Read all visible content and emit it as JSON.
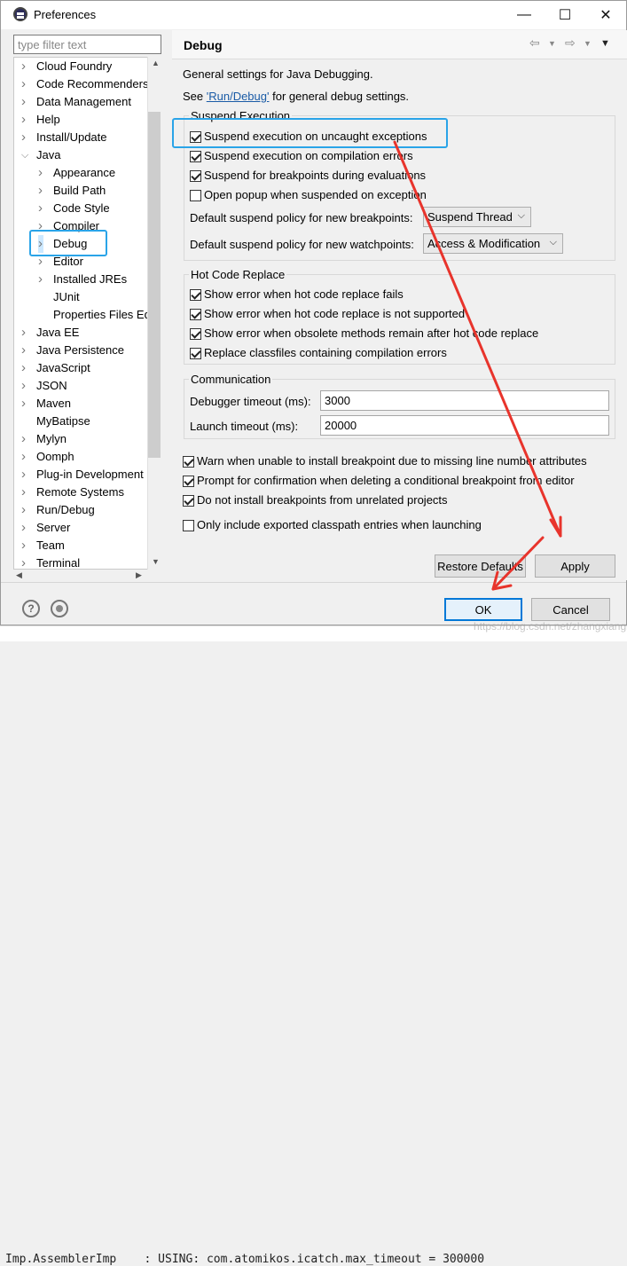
{
  "window": {
    "title": "Preferences",
    "minimize": "—",
    "maximize": "☐",
    "close": "✕"
  },
  "sidebar": {
    "filter_placeholder": "type filter text",
    "items": [
      {
        "label": "Cloud Foundry",
        "level": 0,
        "expand": "closed"
      },
      {
        "label": "Code Recommenders",
        "level": 0,
        "expand": "closed"
      },
      {
        "label": "Data Management",
        "level": 0,
        "expand": "closed"
      },
      {
        "label": "Help",
        "level": 0,
        "expand": "closed"
      },
      {
        "label": "Install/Update",
        "level": 0,
        "expand": "closed"
      },
      {
        "label": "Java",
        "level": 0,
        "expand": "open"
      },
      {
        "label": "Appearance",
        "level": 1,
        "expand": "closed"
      },
      {
        "label": "Build Path",
        "level": 1,
        "expand": "closed"
      },
      {
        "label": "Code Style",
        "level": 1,
        "expand": "closed"
      },
      {
        "label": "Compiler",
        "level": 1,
        "expand": "closed"
      },
      {
        "label": "Debug",
        "level": 1,
        "expand": "closed",
        "selected": true
      },
      {
        "label": "Editor",
        "level": 1,
        "expand": "closed"
      },
      {
        "label": "Installed JREs",
        "level": 1,
        "expand": "closed"
      },
      {
        "label": "JUnit",
        "level": 1,
        "expand": "none"
      },
      {
        "label": "Properties Files Ed",
        "level": 1,
        "expand": "none"
      },
      {
        "label": "Java EE",
        "level": 0,
        "expand": "closed"
      },
      {
        "label": "Java Persistence",
        "level": 0,
        "expand": "closed"
      },
      {
        "label": "JavaScript",
        "level": 0,
        "expand": "closed"
      },
      {
        "label": "JSON",
        "level": 0,
        "expand": "closed"
      },
      {
        "label": "Maven",
        "level": 0,
        "expand": "closed"
      },
      {
        "label": "MyBatipse",
        "level": 0,
        "expand": "none"
      },
      {
        "label": "Mylyn",
        "level": 0,
        "expand": "closed"
      },
      {
        "label": "Oomph",
        "level": 0,
        "expand": "closed"
      },
      {
        "label": "Plug-in Development",
        "level": 0,
        "expand": "closed"
      },
      {
        "label": "Remote Systems",
        "level": 0,
        "expand": "closed"
      },
      {
        "label": "Run/Debug",
        "level": 0,
        "expand": "closed"
      },
      {
        "label": "Server",
        "level": 0,
        "expand": "closed"
      },
      {
        "label": "Team",
        "level": 0,
        "expand": "closed"
      },
      {
        "label": "Terminal",
        "level": 0,
        "expand": "closed"
      }
    ]
  },
  "page": {
    "title": "Debug",
    "intro": "General settings for Java Debugging.",
    "see_prefix": "See ",
    "see_link": "'Run/Debug'",
    "see_suffix": " for general debug settings.",
    "suspend": {
      "group_label": "Suspend Execution",
      "options": [
        {
          "label": "Suspend execution on uncaught exceptions",
          "checked": true
        },
        {
          "label": "Suspend execution on compilation errors",
          "checked": true
        },
        {
          "label": "Suspend for breakpoints during evaluations",
          "checked": true
        },
        {
          "label": "Open popup when suspended on exception",
          "checked": false
        }
      ],
      "bp_policy_label": "Default suspend policy for new breakpoints:",
      "bp_policy_value": "Suspend Thread",
      "wp_policy_label": "Default suspend policy for new watchpoints:",
      "wp_policy_value": "Access & Modification"
    },
    "hcr": {
      "group_label": "Hot Code Replace",
      "options": [
        {
          "label": "Show error when hot code replace fails",
          "checked": true
        },
        {
          "label": "Show error when hot code replace is not supported",
          "checked": true
        },
        {
          "label": "Show error when obsolete methods remain after hot code replace",
          "checked": true
        },
        {
          "label": "Replace classfiles containing compilation errors",
          "checked": true
        }
      ]
    },
    "comm": {
      "group_label": "Communication",
      "debugger_timeout_label": "Debugger timeout (ms):",
      "debugger_timeout_value": "3000",
      "launch_timeout_label": "Launch timeout (ms):",
      "launch_timeout_value": "20000"
    },
    "misc": [
      {
        "label": "Warn when unable to install breakpoint due to missing line number attributes",
        "checked": true
      },
      {
        "label": "Prompt for confirmation when deleting a conditional breakpoint from editor",
        "checked": true
      },
      {
        "label": "Do not install breakpoints from unrelated projects",
        "checked": true
      },
      {
        "label": "Only include exported classpath entries when launching",
        "checked": false
      }
    ],
    "restore_defaults": "Restore Defaults",
    "apply": "Apply"
  },
  "footer": {
    "help_icon": "?",
    "ok": "OK",
    "cancel": "Cancel"
  },
  "background": {
    "bottom_text": "Imp.AssemblerImp    : USING: com.atomikos.icatch.max_timeout = 300000"
  },
  "watermark": "https://blog.csdn.net/zhangxianglo",
  "colors": {
    "highlight": "#2aa4e8",
    "arrow": "#e8342c",
    "primary_button_border": "#0078d7",
    "link": "#1a5ba6"
  }
}
